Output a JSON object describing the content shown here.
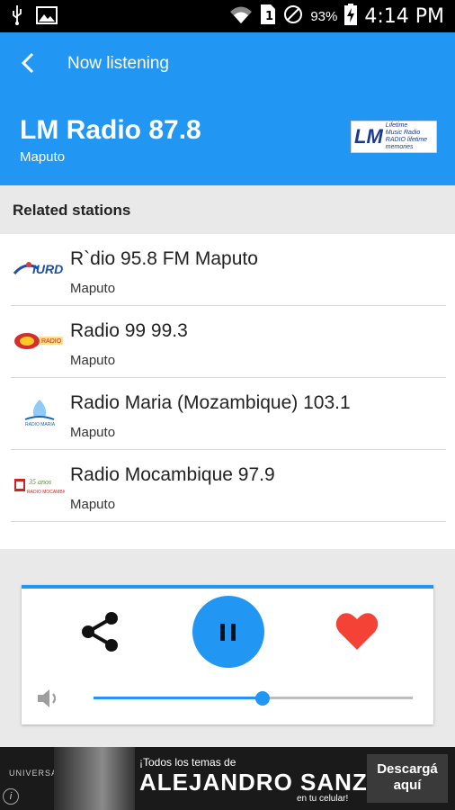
{
  "status_bar": {
    "battery_percent": "93%",
    "time": "4:14 PM"
  },
  "app_bar": {
    "title": "Now listening",
    "station_name": "LM Radio 87.8",
    "station_city": "Maputo",
    "logo": {
      "mark": "LM",
      "tagline_1": "Lifetime",
      "tagline_2": "Music Radio",
      "tagline_3": "RADIO",
      "tagline_4": "lifetime memories"
    }
  },
  "related": {
    "heading": "Related stations",
    "stations": [
      {
        "title": "R`dio 95.8 FM Maputo",
        "city": "Maputo",
        "thumb": "iurd-logo"
      },
      {
        "title": "Radio 99 99.3",
        "city": "Maputo",
        "thumb": "radio99-logo"
      },
      {
        "title": "Radio Maria (Mozambique) 103.1",
        "city": "Maputo",
        "thumb": "radio-maria-logo"
      },
      {
        "title": "Radio Mocambique 97.9",
        "city": "Maputo",
        "thumb": "radio-mocambique-logo"
      }
    ]
  },
  "player": {
    "volume_level": 0.53,
    "accent": "#2196f3",
    "favorite_color": "#f44336"
  },
  "ad": {
    "brand": "UNIVERSAL",
    "line1": "¡Todos los temas de",
    "line2": "ALEJANDRO SANZ",
    "line3": "en tu celular!",
    "cta": "Descargá aquí",
    "info": "i"
  }
}
